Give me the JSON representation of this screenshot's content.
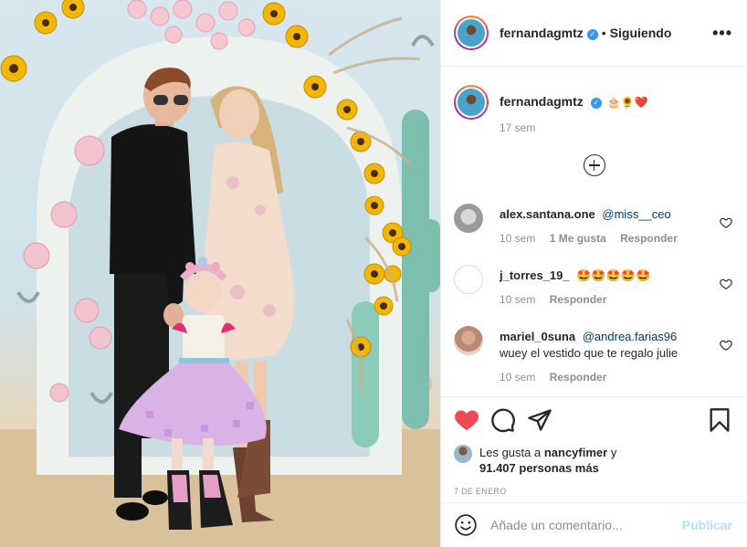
{
  "post": {
    "username": "fernandagmtz",
    "verified_mark": "✓",
    "separator": "•",
    "follow_status": "Siguiendo",
    "more_label": "•••"
  },
  "caption": {
    "username": "fernandagmtz",
    "emojis": "🎂🌻❤️",
    "time": "17 sem"
  },
  "comments": [
    {
      "user": "alex.santana.one",
      "text": "@miss__ceo",
      "text_is_mention": true,
      "time": "10 sem",
      "likes": "1 Me gusta",
      "reply": "Responder"
    },
    {
      "user": "j_torres_19_",
      "text": "🤩🤩🤩🤩🤩",
      "text_is_mention": false,
      "time": "10 sem",
      "likes": "",
      "reply": "Responder"
    },
    {
      "user": "mariel_0suna",
      "text": "@andrea.farias96",
      "text_is_mention": true,
      "text2": "wuey el vestido que te regalo julie",
      "time": "10 sem",
      "likes": "",
      "reply": "Responder"
    }
  ],
  "likes_summary": {
    "prefix": "Les gusta a",
    "user": "nancyfimer",
    "suffix": "y",
    "count": "91.407 personas más"
  },
  "date": "7 DE ENERO",
  "add_comment": {
    "placeholder": "Añade un comentario...",
    "publish_label": "Publicar"
  },
  "icons": {
    "like": "heart-filled-icon",
    "comment": "comment-bubble-icon",
    "share": "paper-plane-icon",
    "save": "bookmark-icon",
    "emoji": "smiley-icon",
    "load_more": "plus-circle-icon",
    "more": "more-options-icon"
  },
  "colors": {
    "like_red": "#ed4956",
    "mention_blue": "#00376b",
    "publish_disabled": "#b2dffc",
    "verified_blue": "#3897f0"
  }
}
